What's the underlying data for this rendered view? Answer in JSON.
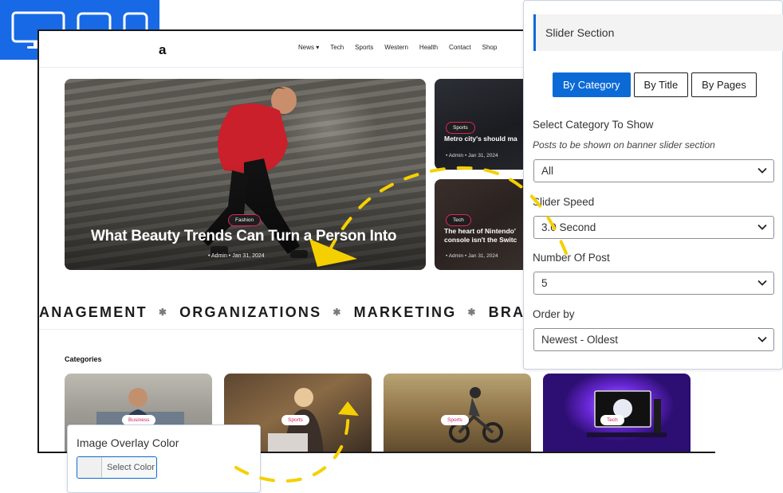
{
  "site": {
    "logo": "a",
    "nav": [
      "News ▾",
      "Tech",
      "Sports",
      "Western",
      "Health",
      "Contact",
      "Shop"
    ],
    "hero": {
      "category": "Fashion",
      "title": "What Beauty Trends Can Turn a Person Into",
      "meta": "•  Admin   •  Jan 31, 2024"
    },
    "side_posts": [
      {
        "category": "Sports",
        "title_lines": [
          "Metro city's should ma"
        ],
        "meta": "•  Admin   •  Jan 31, 2024"
      },
      {
        "category": "Tech",
        "title_lines": [
          "The heart of Nintendo'",
          "console isn't the Switc"
        ],
        "meta": "•  Admin   •  Jan 31, 2024"
      }
    ],
    "ticker": [
      "ANAGEMENT",
      "ORGANIZATIONS",
      "MARKETING",
      "BRANDI"
    ],
    "ticker_separator": "✱",
    "categories_heading": "Categories",
    "category_cards": [
      "Business",
      "Sports",
      "Sports",
      "Tech"
    ]
  },
  "panel": {
    "title": "Slider Section",
    "tabs": [
      {
        "label": "By Category",
        "active": true
      },
      {
        "label": "By Title",
        "active": false
      },
      {
        "label": "By Pages",
        "active": false
      }
    ],
    "fields": [
      {
        "label": "Select Category To Show",
        "description": "Posts to be shown on banner slider section",
        "value": "All"
      },
      {
        "label": "Slider Speed",
        "value": "3.0 Second"
      },
      {
        "label": "Number Of Post",
        "value": "5"
      },
      {
        "label": "Order by",
        "value": "Newest - Oldest"
      }
    ]
  },
  "overlay_color": {
    "label": "Image Overlay Color",
    "button_label": "Select Color"
  },
  "colors": {
    "accent": "#0c6ad6",
    "device_bar": "#1769e6",
    "arrow": "#f5d000",
    "tag_border": "#e0245e"
  },
  "icons": [
    "desktop-icon",
    "tablet-icon",
    "mobile-icon",
    "chevron-down-icon"
  ]
}
